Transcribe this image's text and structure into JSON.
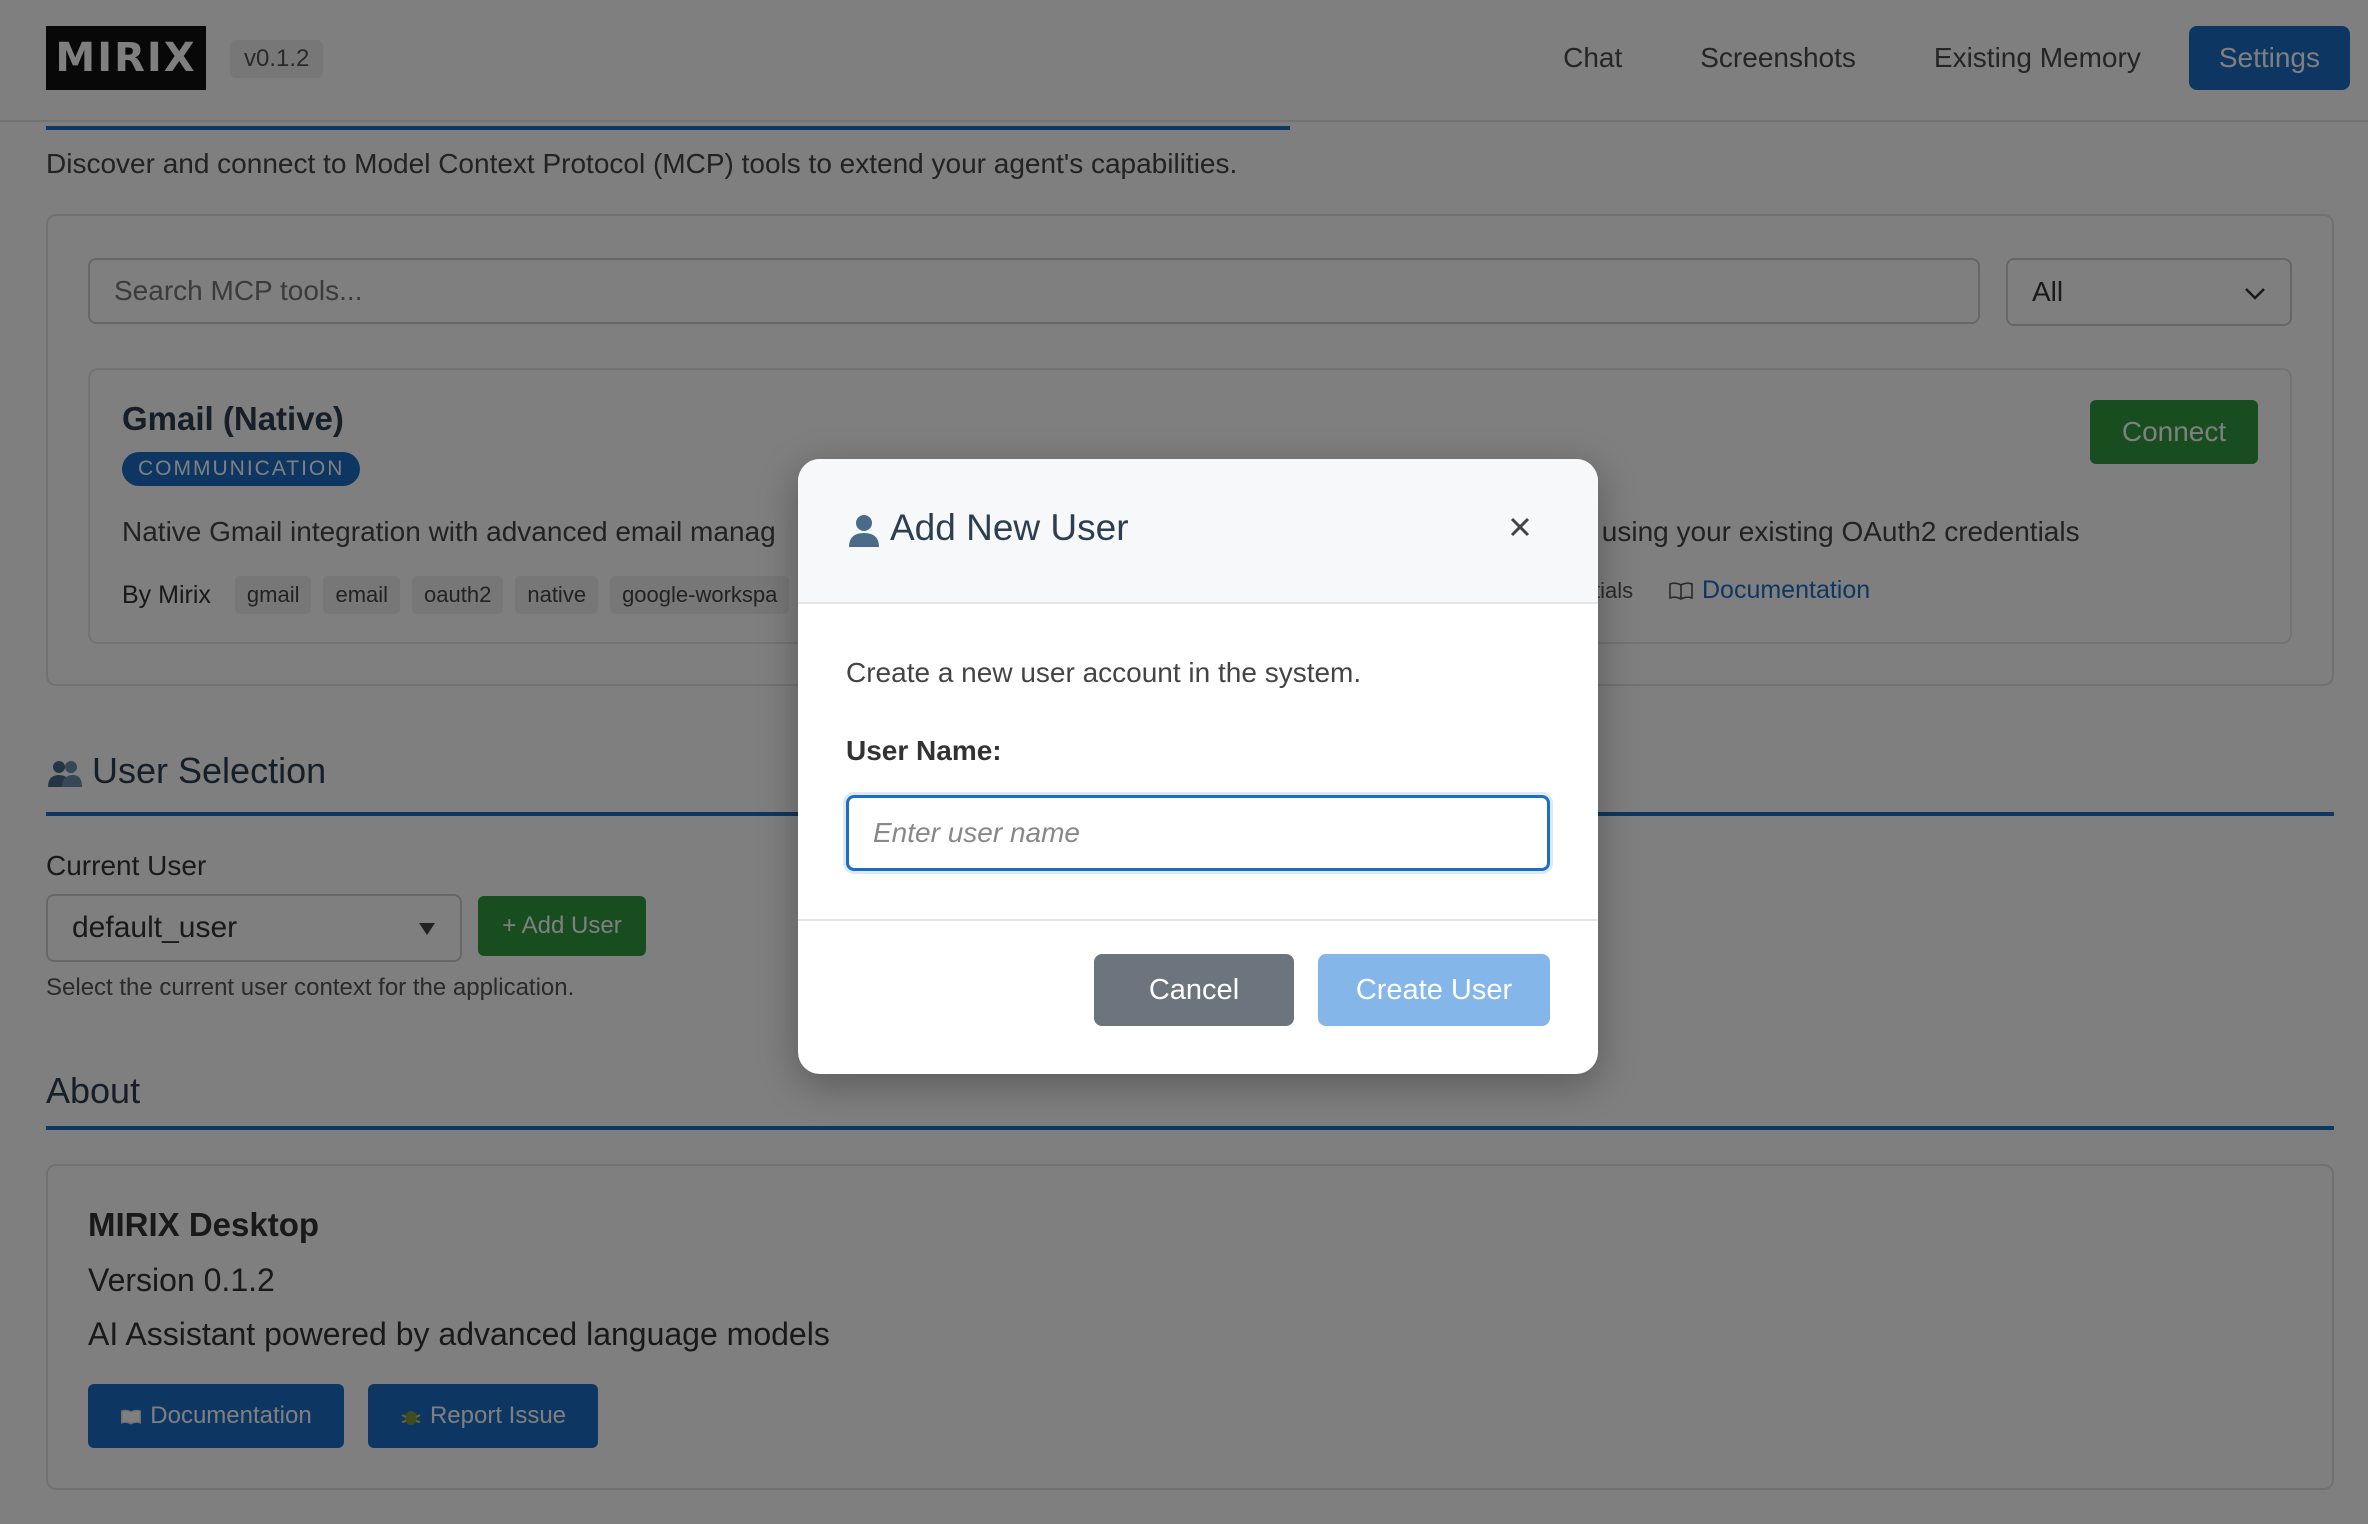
{
  "header": {
    "logo_text": "MIRIX",
    "version": "v0.1.2",
    "nav": [
      {
        "label": "Chat",
        "active": false
      },
      {
        "label": "Screenshots",
        "active": false
      },
      {
        "label": "Existing Memory",
        "active": false
      },
      {
        "label": "Settings",
        "active": true
      }
    ]
  },
  "mcp": {
    "description": "Discover and connect to Model Context Protocol (MCP) tools to extend your agent's capabilities.",
    "search_placeholder": "Search MCP tools...",
    "filter_value": "All",
    "tool": {
      "title": "Gmail (Native)",
      "category": "COMMUNICATION",
      "connect_label": "Connect",
      "description_left": "Native Gmail integration with advanced email manag",
      "description_right": "s using your existing OAuth2 credentials",
      "by": "By Mirix",
      "tags": [
        "gmail",
        "email",
        "oauth2",
        "native",
        "google-workspa"
      ],
      "meta_right": "tials",
      "doc_link": "Documentation"
    }
  },
  "user_selection": {
    "title": "User Selection",
    "label": "Current User",
    "current_user": "default_user",
    "add_user_label": "+ Add User",
    "help": "Select the current user context for the application."
  },
  "about": {
    "title": "About",
    "app_name": "MIRIX Desktop",
    "version": "Version 0.1.2",
    "description": "AI Assistant powered by advanced language models",
    "doc_button": "Documentation",
    "issue_button": "Report Issue"
  },
  "modal": {
    "title": "Add New User",
    "description": "Create a new user account in the system.",
    "field_label": "User Name:",
    "input_value": "",
    "input_placeholder": "Enter user name",
    "cancel_label": "Cancel",
    "create_label": "Create User"
  },
  "colors": {
    "primary": "#1a6fc4",
    "success": "#2e9a3e",
    "secondary": "#6c757d",
    "disabled_primary": "#84b6e9"
  }
}
